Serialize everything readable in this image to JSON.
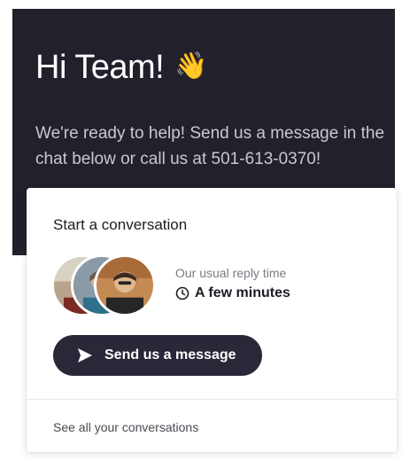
{
  "hero": {
    "greeting": "Hi Team!",
    "greeting_emoji": "👋",
    "intro_text": "We're ready to help! Send us a message in the chat below or call us at 501-613-0370!",
    "background_color": "#22202a"
  },
  "card": {
    "title": "Start a conversation",
    "reply_label": "Our usual reply time",
    "reply_time": "A few minutes",
    "send_button_label": "Send us a message",
    "see_all_label": "See all your conversations",
    "button_color": "#2a2738"
  },
  "icons": {
    "wave": "waving-hand-icon",
    "clock": "clock-icon",
    "send": "paper-plane-icon"
  }
}
